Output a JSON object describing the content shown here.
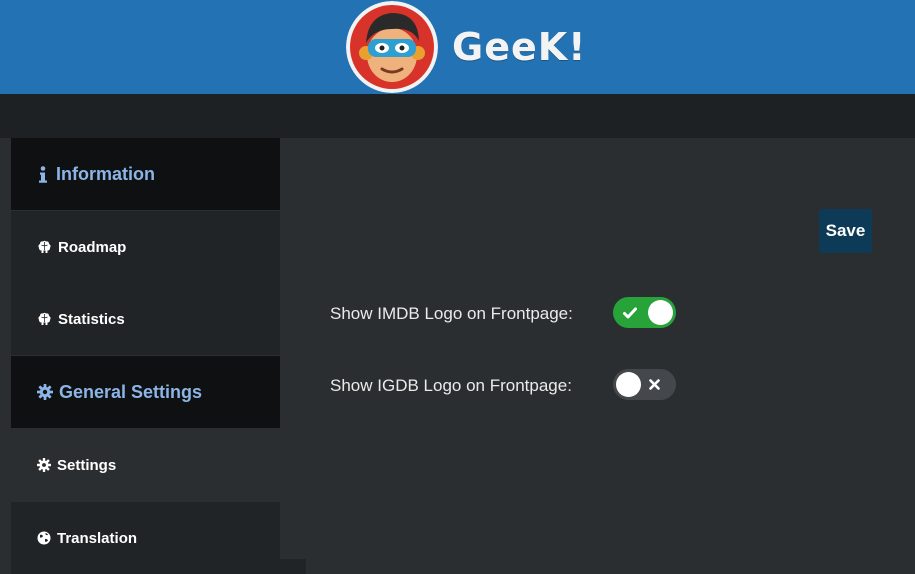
{
  "header": {
    "brand_name": "GeeK!",
    "logo_icon": "superhero-mascot-logo",
    "background_color": "#2272b4"
  },
  "sidebar": {
    "items": [
      {
        "label": "Information",
        "icon": "info-icon",
        "kind": "section"
      },
      {
        "label": "Roadmap",
        "icon": "brain-icon",
        "kind": "link"
      },
      {
        "label": "Statistics",
        "icon": "brain-icon",
        "kind": "link"
      },
      {
        "label": "General Settings",
        "icon": "gear-icon",
        "kind": "section"
      },
      {
        "label": "Settings",
        "icon": "gear-icon",
        "kind": "link",
        "active": true
      },
      {
        "label": "Translation",
        "icon": "globe-icon",
        "kind": "link"
      }
    ],
    "section_text_color": "#8cb4e6"
  },
  "main": {
    "save_label": "Save",
    "settings": [
      {
        "label": "Show IMDB Logo on Frontpage:",
        "enabled": true
      },
      {
        "label": "Show IGDB Logo on Frontpage:",
        "enabled": false
      }
    ],
    "toggle_on_color": "#28a33a",
    "toggle_off_color": "#44484c"
  }
}
